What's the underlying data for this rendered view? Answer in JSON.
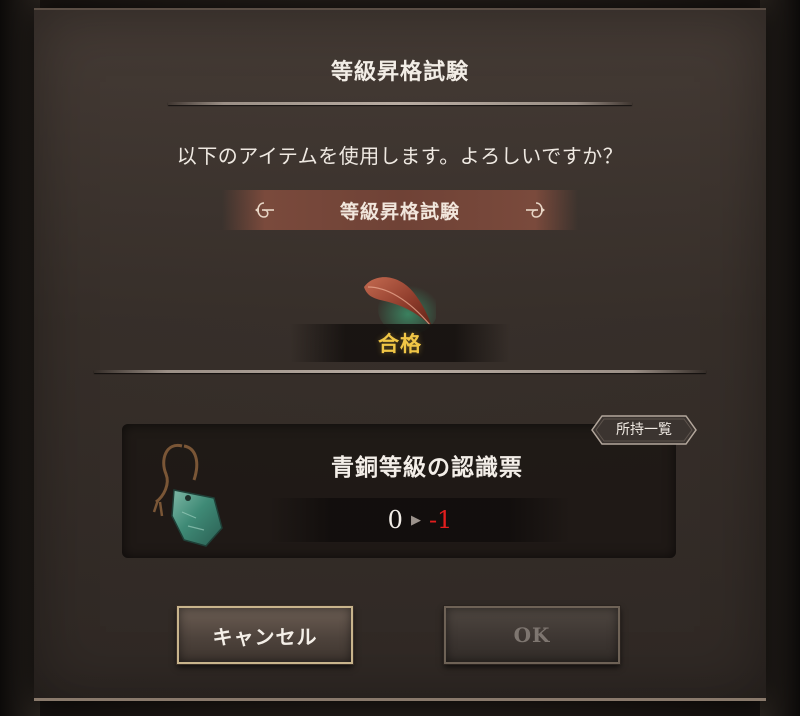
{
  "dialog": {
    "title": "等級昇格試験",
    "question": "以下のアイテムを使用します。よろしいですか？",
    "banner_label": "等級昇格試験",
    "result_label": "合格"
  },
  "item": {
    "name": "青銅等級の認識票",
    "count_from": "0",
    "count_to": "-1",
    "owned_list_label": "所持一覧"
  },
  "buttons": {
    "cancel_label": "キャンセル",
    "ok_label": "OK"
  },
  "colors": {
    "result": "#f0c646",
    "count_to": "#e21e1e",
    "banner": "#6f4236"
  },
  "icons": {
    "banner_left": "scroll-ornament-left-icon",
    "banner_right": "scroll-ornament-right-icon",
    "test_item": "feather-icon",
    "item": "bronze-tag-icon",
    "arrow": "triangle-right-icon"
  }
}
